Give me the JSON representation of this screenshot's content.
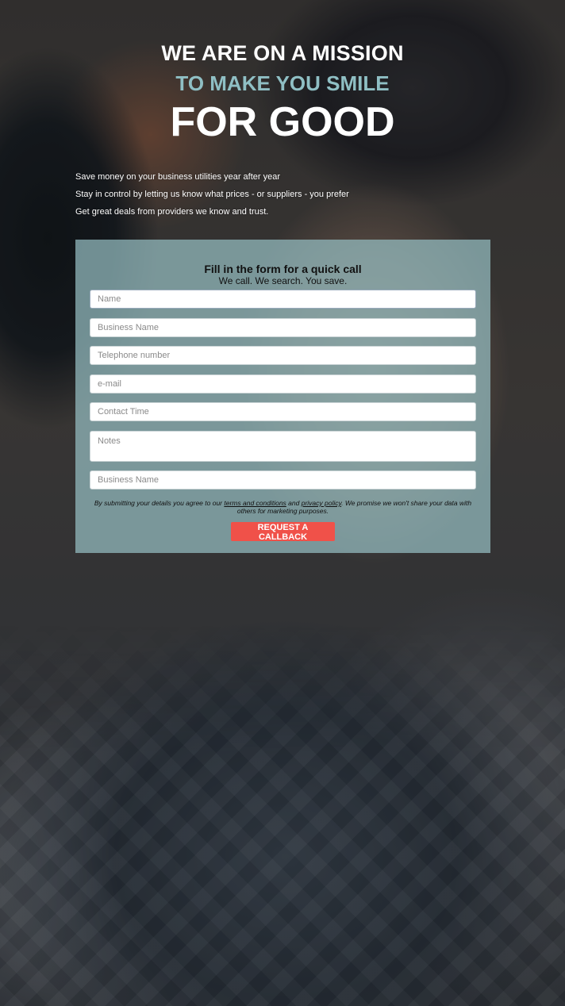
{
  "hero": {
    "line1": "WE ARE ON A MISSION",
    "line2": "TO MAKE YOU SMILE",
    "line3": "FOR GOOD"
  },
  "benefits": [
    "Save money on your business utilities year after year",
    "Stay in control by letting us know what prices - or suppliers - you prefer",
    "Get great deals from providers we know and trust."
  ],
  "form": {
    "title": "Fill in the form for a quick call",
    "subtitle": "We call. We search. You save.",
    "fields": {
      "name": {
        "placeholder": "Name",
        "value": ""
      },
      "business_name": {
        "placeholder": "Business Name",
        "value": ""
      },
      "telephone": {
        "placeholder": "Telephone number",
        "value": ""
      },
      "email": {
        "placeholder": "e-mail",
        "value": ""
      },
      "contact_time": {
        "placeholder": "Contact Time",
        "value": ""
      },
      "notes": {
        "placeholder": "Notes",
        "value": ""
      },
      "business_name_2": {
        "placeholder": "Business Name",
        "value": ""
      }
    },
    "disclaimer": {
      "before": "By submitting your details you agree to our ",
      "terms_link": "terms and conditions",
      "and": " and ",
      "privacy_link": "privacy policy",
      "after": ". We promise we won't share your data with others for marketing purposes."
    },
    "submit_label": "REQUEST A CALLBACK"
  },
  "colors": {
    "accent_teal": "#8fbfc4",
    "panel": "#96bec2",
    "button": "#f05149"
  }
}
